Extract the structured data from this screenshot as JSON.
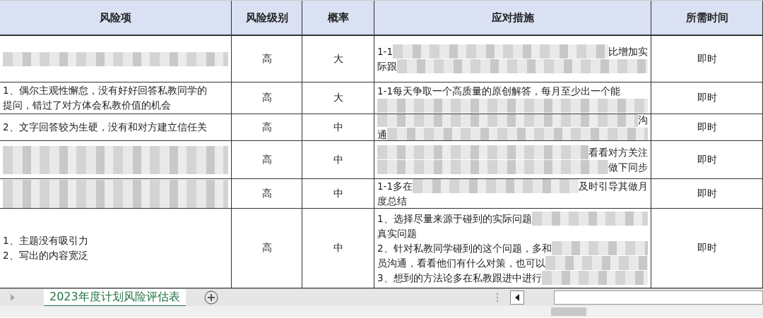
{
  "table": {
    "columns": [
      "风险项",
      "风险级别",
      "概率",
      "应对措施",
      "所需时间"
    ],
    "rows": [
      {
        "risk": [
          [
            {
              "kind": "redacted"
            }
          ]
        ],
        "level": "高",
        "probability": "大",
        "measures": [
          [
            {
              "kind": "text",
              "text": "1-1"
            },
            {
              "kind": "redacted"
            },
            {
              "kind": "text",
              "text": "比增加实"
            }
          ],
          [
            {
              "kind": "text",
              "text": "际跟"
            },
            {
              "kind": "redacted"
            }
          ]
        ],
        "time": "即时"
      },
      {
        "risk": [
          [
            {
              "kind": "text",
              "text": "1、偶尔主观性懈怠，没有好好回答私教同学的"
            }
          ],
          [
            {
              "kind": "text",
              "text": "提问，错过了对方体会私教价值的机会"
            }
          ]
        ],
        "level": "高",
        "probability": "大",
        "measures": [
          [
            {
              "kind": "text",
              "text": "1-1每天争取一个高质量的原创解答，每月至少出一个能"
            }
          ],
          [
            {
              "kind": "redacted"
            }
          ]
        ],
        "time": "即时"
      },
      {
        "risk": [
          [
            {
              "kind": "text",
              "text": "2、文字回答较为生硬，没有和对方建立信任关"
            }
          ]
        ],
        "level": "高",
        "probability": "中",
        "measures": [
          [
            {
              "kind": "redacted"
            },
            {
              "kind": "text",
              "text": "沟"
            }
          ],
          [
            {
              "kind": "text",
              "text": "通"
            },
            {
              "kind": "redacted"
            }
          ]
        ],
        "time": "即时"
      },
      {
        "risk": [
          [
            {
              "kind": "redacted"
            }
          ],
          [
            {
              "kind": "redacted"
            }
          ]
        ],
        "level": "高",
        "probability": "中",
        "measures": [
          [
            {
              "kind": "redacted"
            },
            {
              "kind": "text",
              "text": "看看对方关注"
            }
          ],
          [
            {
              "kind": "redacted"
            },
            {
              "kind": "text",
              "text": "做下同步"
            }
          ]
        ],
        "time": "即时"
      },
      {
        "risk": [
          [
            {
              "kind": "redacted"
            }
          ],
          [
            {
              "kind": "redacted"
            }
          ]
        ],
        "level": "高",
        "probability": "中",
        "measures": [
          [
            {
              "kind": "text",
              "text": "1-1多在"
            },
            {
              "kind": "redacted"
            },
            {
              "kind": "text",
              "text": "及时引导其做月"
            }
          ],
          [
            {
              "kind": "text",
              "text": "度总结"
            }
          ]
        ],
        "time": "即时"
      },
      {
        "risk": [
          [
            {
              "kind": "text",
              "text": "1、主题没有吸引力"
            }
          ],
          [
            {
              "kind": "text",
              "text": "2、写出的内容宽泛"
            }
          ]
        ],
        "level": "高",
        "probability": "中",
        "measures": [
          [
            {
              "kind": "text",
              "text": "1、选择尽量来源于碰到的实际问题"
            },
            {
              "kind": "redacted"
            }
          ],
          [
            {
              "kind": "text",
              "text": "真实问题"
            }
          ],
          [
            {
              "kind": "text",
              "text": "2、针对私教同学碰到的这个问题，多和"
            },
            {
              "kind": "redacted"
            }
          ],
          [
            {
              "kind": "text",
              "text": "员沟通，看看他们有什么对策，也可以"
            },
            {
              "kind": "redacted"
            }
          ],
          [
            {
              "kind": "text",
              "text": "3、想到的方法论多在私教跟进中进行"
            },
            {
              "kind": "redacted"
            }
          ]
        ],
        "time": "即时"
      }
    ]
  },
  "sheet_tabs": [
    {
      "label": "2023年度计划风险评估表",
      "selected": true
    }
  ]
}
